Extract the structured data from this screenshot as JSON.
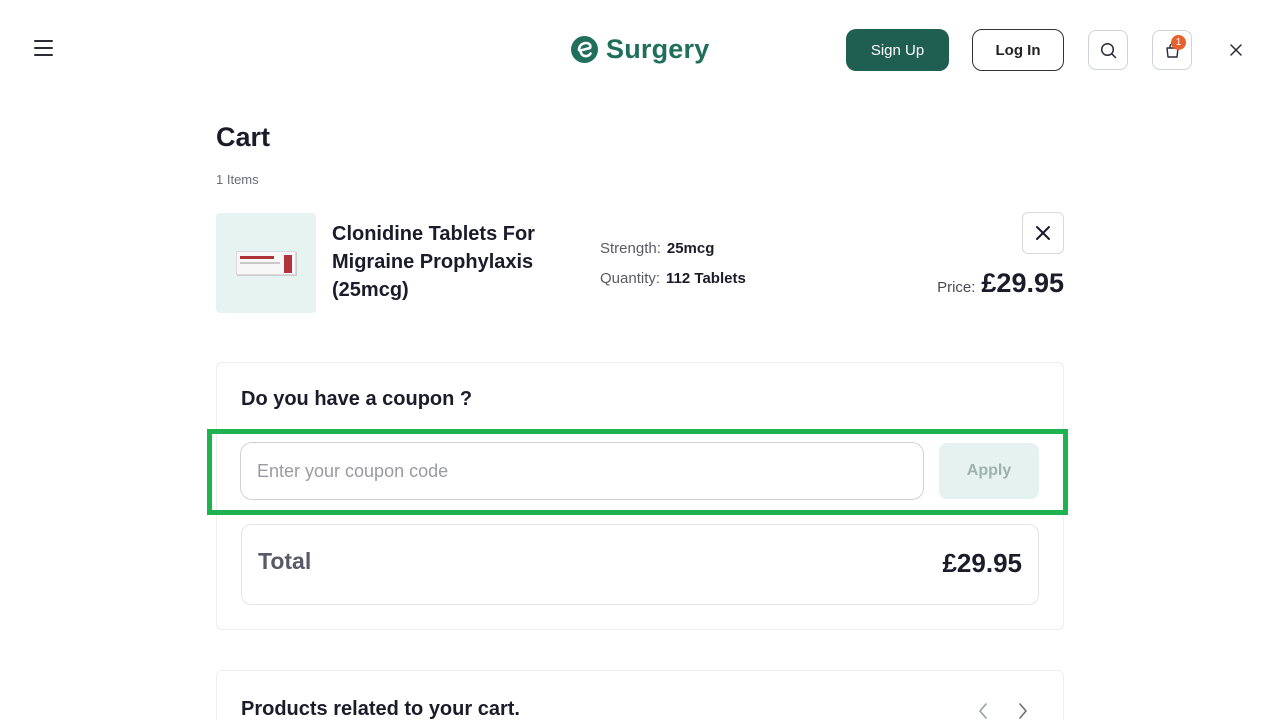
{
  "header": {
    "brand": "Surgery",
    "signup_label": "Sign Up",
    "login_label": "Log In",
    "cart_badge": "1",
    "icons": [
      "hamburger-menu-icon",
      "brand-logo-icon",
      "search-icon",
      "shopping-bag-icon",
      "close-icon"
    ]
  },
  "cart": {
    "title": "Cart",
    "item_count": "1 Items",
    "items": [
      {
        "name": "Clonidine Tablets For Migraine Prophylaxis (25mcg)",
        "strength_label": "Strength:",
        "strength_value": "25mcg",
        "quantity_label": "Quantity:",
        "quantity_value": "112 Tablets",
        "price_label": "Price:",
        "price_value": "£29.95"
      }
    ]
  },
  "coupon": {
    "title": "Do you have a coupon ?",
    "placeholder": "Enter your coupon code",
    "value": "",
    "apply_label": "Apply"
  },
  "summary": {
    "total_label": "Total",
    "total_value": "£29.95"
  },
  "related": {
    "title": "Products related to your cart."
  },
  "colors": {
    "brand": "#1f6f5c",
    "signup_bg": "#1f5f52",
    "badge": "#e8602c",
    "highlight": "#1fb34f",
    "apply_bg": "#e6f2ef",
    "thumb_bg": "#e7f3f1"
  }
}
